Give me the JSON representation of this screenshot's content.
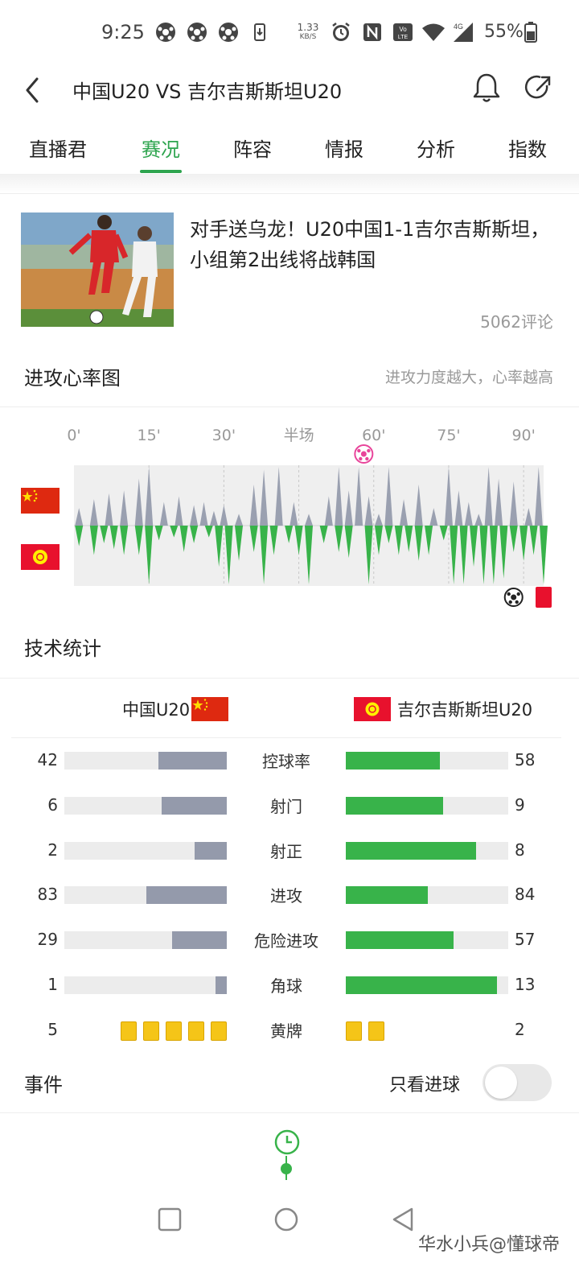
{
  "status_bar": {
    "time": "9:25",
    "net_speed_value": "1.33",
    "net_speed_unit": "KB/S",
    "battery": "55%",
    "icons": [
      "soccer-ball-icon",
      "soccer-ball-icon",
      "soccer-ball-icon",
      "download-icon",
      "alarm-icon",
      "nfc-icon",
      "volte-icon",
      "wifi-icon",
      "signal-4g-icon",
      "battery-icon"
    ]
  },
  "header": {
    "title": "中国U20 VS 吉尔吉斯斯坦U20",
    "icons": [
      "back-icon",
      "bell-icon",
      "share-icon"
    ]
  },
  "tabs": [
    {
      "label": "直播君",
      "active": false
    },
    {
      "label": "赛况",
      "active": true
    },
    {
      "label": "阵容",
      "active": false
    },
    {
      "label": "情报",
      "active": false
    },
    {
      "label": "分析",
      "active": false
    },
    {
      "label": "指数",
      "active": false
    }
  ],
  "colors": {
    "accent": "#2da44e",
    "home_bar": "#949aab",
    "away_bar": "#38b34a",
    "china_red": "#de2910",
    "kyrgyz_red": "#e8112d",
    "yellow_card": "#f5c518",
    "red_card": "#e8112d"
  },
  "news": {
    "title": "对手送乌龙！U20中国1-1吉尔吉斯斯坦，小组第2出线将战韩国",
    "comments": "5062评论"
  },
  "heart_chart": {
    "title": "进攻心率图",
    "description": "进攻力度越大，心率越高",
    "time_labels": [
      "0'",
      "15'",
      "30'",
      "半场",
      "60'",
      "75'",
      "90'"
    ],
    "chart_data": {
      "type": "area",
      "x_range": [
        0,
        94
      ],
      "home_series": {
        "team": "中国U20",
        "peaks": [
          [
            1,
            0.3
          ],
          [
            4,
            0.45
          ],
          [
            7,
            0.55
          ],
          [
            10,
            0.6
          ],
          [
            13,
            0.8
          ],
          [
            15,
            1.0
          ],
          [
            18,
            0.4
          ],
          [
            21,
            0.5
          ],
          [
            24,
            0.35
          ],
          [
            26,
            0.4
          ],
          [
            28,
            0.25
          ],
          [
            30,
            0.35
          ],
          [
            33,
            0.2
          ],
          [
            36,
            0.7
          ],
          [
            38,
            0.95
          ],
          [
            41,
            1.0
          ],
          [
            44,
            0.4
          ],
          [
            47,
            0.2
          ],
          [
            51,
            0.5
          ],
          [
            53,
            1.0
          ],
          [
            55,
            0.6
          ],
          [
            57,
            1.0
          ],
          [
            59,
            0.5
          ],
          [
            61,
            0.2
          ],
          [
            63,
            1.0
          ],
          [
            66,
            0.45
          ],
          [
            69,
            0.7
          ],
          [
            72,
            0.3
          ],
          [
            75,
            1.0
          ],
          [
            77,
            0.6
          ],
          [
            79,
            0.4
          ],
          [
            81,
            0.2
          ],
          [
            83,
            1.0
          ],
          [
            85,
            0.8
          ],
          [
            88,
            0.75
          ],
          [
            91,
            0.3
          ],
          [
            93,
            1.0
          ]
        ]
      },
      "away_series": {
        "team": "吉尔吉斯斯坦U20",
        "peaks": [
          [
            1,
            0.35
          ],
          [
            4,
            0.5
          ],
          [
            6,
            0.3
          ],
          [
            8,
            0.4
          ],
          [
            10,
            0.5
          ],
          [
            13,
            0.5
          ],
          [
            15,
            1.0
          ],
          [
            17,
            0.25
          ],
          [
            20,
            0.2
          ],
          [
            22,
            0.45
          ],
          [
            24,
            0.3
          ],
          [
            27,
            0.2
          ],
          [
            29,
            0.7
          ],
          [
            31,
            1.0
          ],
          [
            33,
            0.6
          ],
          [
            36,
            0.45
          ],
          [
            38,
            1.0
          ],
          [
            40,
            0.5
          ],
          [
            43,
            0.3
          ],
          [
            45,
            0.5
          ],
          [
            47,
            1.0
          ],
          [
            50,
            0.3
          ],
          [
            53,
            0.45
          ],
          [
            55,
            0.55
          ],
          [
            59,
            1.0
          ],
          [
            61,
            0.5
          ],
          [
            63,
            0.3
          ],
          [
            65,
            0.5
          ],
          [
            67,
            0.45
          ],
          [
            69,
            0.6
          ],
          [
            71,
            0.5
          ],
          [
            74,
            0.25
          ],
          [
            76,
            1.0
          ],
          [
            78,
            1.0
          ],
          [
            80,
            0.7
          ],
          [
            82,
            1.0
          ],
          [
            84,
            1.0
          ],
          [
            86,
            0.9
          ],
          [
            88,
            0.45
          ],
          [
            90,
            0.6
          ],
          [
            92,
            0.5
          ],
          [
            94,
            1.0
          ]
        ]
      },
      "events": [
        {
          "type": "goal",
          "team": "home",
          "minute": 58,
          "icon": "soccer-ball-pink-icon"
        },
        {
          "type": "goal",
          "team": "away",
          "minute": 88,
          "icon": "soccer-ball-icon"
        },
        {
          "type": "red_card",
          "team": "away",
          "minute": 94,
          "icon": "red-card-icon"
        }
      ]
    }
  },
  "stats": {
    "title": "技术统计",
    "home_team": "中国U20",
    "away_team": "吉尔吉斯斯坦U20",
    "rows": [
      {
        "label": "控球率",
        "home": "42",
        "away": "58",
        "home_ratio": 0.42,
        "away_ratio": 0.58
      },
      {
        "label": "射门",
        "home": "6",
        "away": "9",
        "home_ratio": 0.4,
        "away_ratio": 0.6
      },
      {
        "label": "射正",
        "home": "2",
        "away": "8",
        "home_ratio": 0.2,
        "away_ratio": 0.8
      },
      {
        "label": "进攻",
        "home": "83",
        "away": "84",
        "home_ratio": 0.497,
        "away_ratio": 0.503
      },
      {
        "label": "危险进攻",
        "home": "29",
        "away": "57",
        "home_ratio": 0.337,
        "away_ratio": 0.663
      },
      {
        "label": "角球",
        "home": "1",
        "away": "13",
        "home_ratio": 0.071,
        "away_ratio": 0.929
      }
    ],
    "yellow_cards": {
      "label": "黄牌",
      "home": "5",
      "away": "2",
      "home_count": 5,
      "away_count": 2
    }
  },
  "events_section": {
    "title": "事件",
    "goals_only_label": "只看进球",
    "goals_only_on": false
  },
  "watermark": "华水小兵@懂球帝"
}
